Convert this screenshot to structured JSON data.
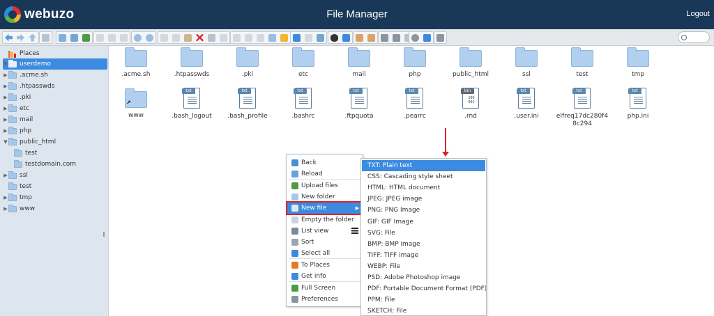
{
  "header": {
    "brand": "webuzo",
    "title": "File Manager",
    "logout": "Logout"
  },
  "search": {
    "value": ""
  },
  "sidebar": {
    "places": "Places",
    "root": "userdemo",
    "items": [
      {
        "label": ".acme.sh",
        "expandable": true,
        "indent": 1
      },
      {
        "label": ".htpasswds",
        "expandable": true,
        "indent": 1
      },
      {
        "label": ".pki",
        "expandable": true,
        "indent": 1
      },
      {
        "label": "etc",
        "expandable": true,
        "indent": 1
      },
      {
        "label": "mail",
        "expandable": true,
        "indent": 1
      },
      {
        "label": "php",
        "expandable": true,
        "indent": 1
      },
      {
        "label": "public_html",
        "expandable": true,
        "expanded": true,
        "indent": 1
      },
      {
        "label": "test",
        "expandable": false,
        "indent": 2
      },
      {
        "label": "testdomain.com",
        "expandable": false,
        "indent": 2
      },
      {
        "label": "ssl",
        "expandable": true,
        "indent": 1
      },
      {
        "label": "test",
        "expandable": false,
        "indent": 1
      },
      {
        "label": "tmp",
        "expandable": true,
        "indent": 1
      },
      {
        "label": "www",
        "expandable": true,
        "indent": 1,
        "link": true
      }
    ]
  },
  "files": [
    {
      "name": ".acme.sh",
      "type": "folder"
    },
    {
      "name": ".htpasswds",
      "type": "folder"
    },
    {
      "name": ".pki",
      "type": "folder"
    },
    {
      "name": "etc",
      "type": "folder"
    },
    {
      "name": "mail",
      "type": "folder"
    },
    {
      "name": "php",
      "type": "folder"
    },
    {
      "name": "public_html",
      "type": "folder"
    },
    {
      "name": "ssl",
      "type": "folder"
    },
    {
      "name": "test",
      "type": "folder"
    },
    {
      "name": "tmp",
      "type": "folder"
    },
    {
      "name": "www",
      "type": "folder-link"
    },
    {
      "name": ".bash_logout",
      "type": "txt",
      "tag": "txt"
    },
    {
      "name": ".bash_profile",
      "type": "txt",
      "tag": "txt"
    },
    {
      "name": ".bashrc",
      "type": "txt",
      "tag": "txt"
    },
    {
      "name": ".ftpquota",
      "type": "txt",
      "tag": "txt"
    },
    {
      "name": ".pearrc",
      "type": "txt",
      "tag": "txt"
    },
    {
      "name": ".rnd",
      "type": "bin",
      "tag": "bin"
    },
    {
      "name": ".user.ini",
      "type": "txt",
      "tag": "txt"
    },
    {
      "name": "elfreq17dc280f48c294",
      "type": "txt",
      "tag": "txt"
    },
    {
      "name": "php.ini",
      "type": "txt",
      "tag": "txt"
    }
  ],
  "context_menu": {
    "items": [
      {
        "label": "Back",
        "icon": "back-arrow-icon",
        "color": "#4a8fd6"
      },
      {
        "label": "Reload",
        "icon": "reload-icon",
        "color": "#6a9fd8"
      },
      {
        "label": "Upload files",
        "icon": "upload-icon",
        "color": "#4f9a48"
      },
      {
        "label": "New folder",
        "icon": "new-folder-icon",
        "color": "#a7c7e8"
      },
      {
        "label": "New file",
        "icon": "new-file-icon",
        "color": "#dfe7f0",
        "active": true,
        "submenu": true
      },
      {
        "label": "Empty the folder",
        "icon": "empty-folder-icon",
        "color": "#c9d4de"
      },
      {
        "label": "List view",
        "icon": "list-view-icon",
        "color": "#7a8a99"
      },
      {
        "label": "Sort",
        "icon": "sort-icon",
        "color": "#9aa6b2"
      },
      {
        "label": "Select all",
        "icon": "select-all-icon",
        "color": "#3c8be0"
      },
      {
        "label": "To Places",
        "icon": "places-icon",
        "color": "#e07b2a"
      },
      {
        "label": "Get info",
        "icon": "info-icon",
        "color": "#3c8be0"
      },
      {
        "label": "Full Screen",
        "icon": "fullscreen-icon",
        "color": "#4f9a48"
      },
      {
        "label": "Preferences",
        "icon": "gear-icon",
        "color": "#8a959f"
      }
    ]
  },
  "submenu": {
    "items": [
      "TXT: Plain text",
      "CSS: Cascading style sheet",
      "HTML: HTML document",
      "JPEG: JPEG image",
      "PNG: PNG Image",
      "GIF: GIF Image",
      "SVG: File",
      "BMP: BMP image",
      "TIFF: TIFF image",
      "WEBP: File",
      "PSD: Adobe Photoshop image",
      "PDF: Portable Document Format (PDF)",
      "PPM: File",
      "SKETCH: File"
    ],
    "highlighted": 0
  },
  "colors": {
    "header": "#193858",
    "accent": "#3c8be0",
    "annotation": "#d9232b"
  }
}
